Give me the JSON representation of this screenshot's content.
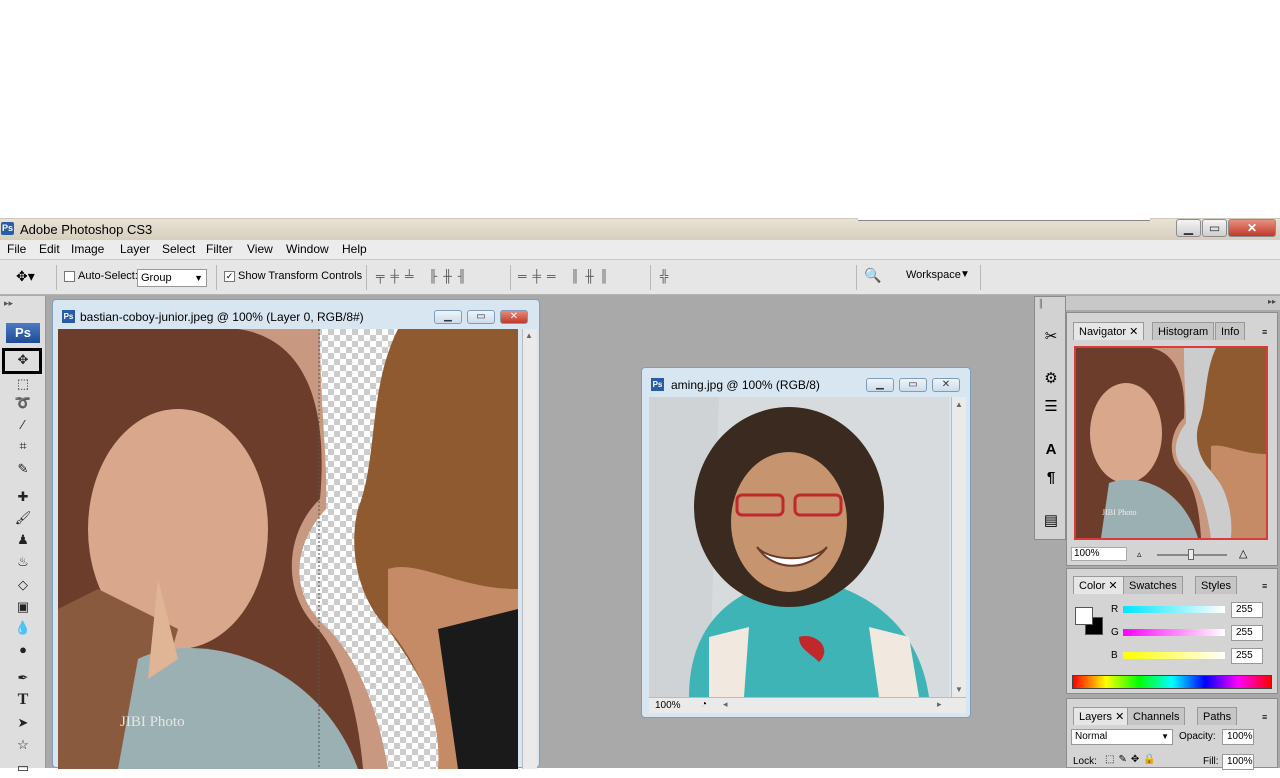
{
  "app": {
    "title": "Adobe Photoshop CS3",
    "icon": "Ps"
  },
  "menu": [
    "File",
    "Edit",
    "Image",
    "Layer",
    "Select",
    "Filter",
    "View",
    "Window",
    "Help"
  ],
  "options": {
    "auto_select_label": "Auto-Select:",
    "auto_select_value": "Group",
    "show_transform_label": "Show Transform Controls",
    "workspace_label": "Workspace"
  },
  "toolbar_logo": "Ps",
  "doc1": {
    "title": "bastian-coboy-junior.jpeg @ 100% (Layer 0, RGB/8#)",
    "watermark": "JIBI Photo"
  },
  "doc2": {
    "title": "aming.jpg @ 100% (RGB/8)",
    "zoom": "100%"
  },
  "navigator": {
    "tabs": [
      "Navigator",
      "Histogram",
      "Info"
    ],
    "zoom": "100%",
    "thumb_watermark": "JIBI Photo"
  },
  "color_panel": {
    "tabs": [
      "Color",
      "Swatches",
      "Styles"
    ],
    "channels": [
      {
        "label": "R",
        "value": "255",
        "color": "#00e5ff"
      },
      {
        "label": "G",
        "value": "255",
        "color": "#ff00ff"
      },
      {
        "label": "B",
        "value": "255",
        "color": "#ffff00"
      }
    ]
  },
  "layers_panel": {
    "tabs": [
      "Layers",
      "Channels",
      "Paths"
    ],
    "blend_mode": "Normal",
    "opacity_label": "Opacity:",
    "opacity_value": "100%",
    "lock_label": "Lock:",
    "fill_label": "Fill:",
    "fill_value": "100%"
  },
  "colors": {
    "accent": "#2a5da8",
    "close_red": "#c0392b",
    "highlight_border": "#000000"
  }
}
